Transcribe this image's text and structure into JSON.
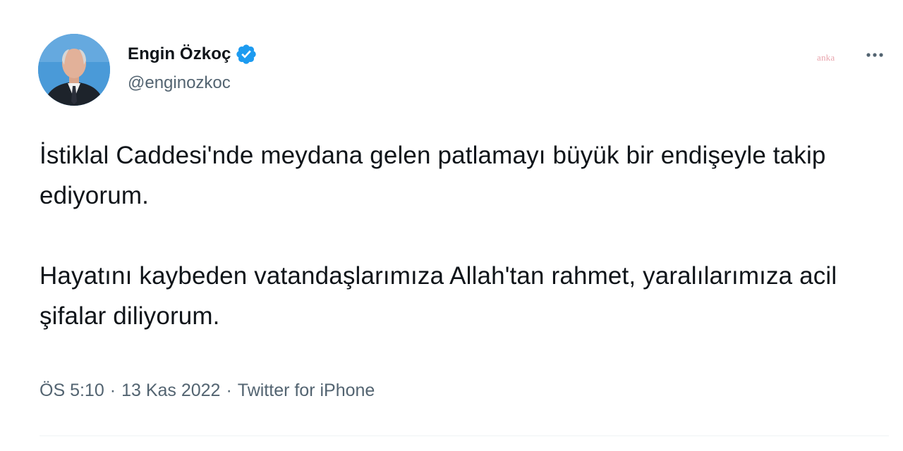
{
  "author": {
    "display_name": "Engin Özkoç",
    "handle": "@enginozkoc",
    "verified": true,
    "avatar_icon": "profile-photo"
  },
  "watermark": "anka",
  "menu": {
    "icon": "more-options-icon"
  },
  "tweet": {
    "text": "İstiklal Caddesi'nde meydana gelen patlamayı büyük bir endişeyle takip ediyorum.\n\nHayatını kaybeden vatandaşlarımıza Allah'tan rahmet, yaralılarımıza acil şifalar diliyorum."
  },
  "meta": {
    "time": "ÖS 5:10",
    "separator": "·",
    "date": "13 Kas 2022",
    "source": "Twitter for iPhone"
  },
  "colors": {
    "verified_blue": "#1d9bf0",
    "secondary_text": "#536471",
    "primary_text": "#0f1419"
  }
}
